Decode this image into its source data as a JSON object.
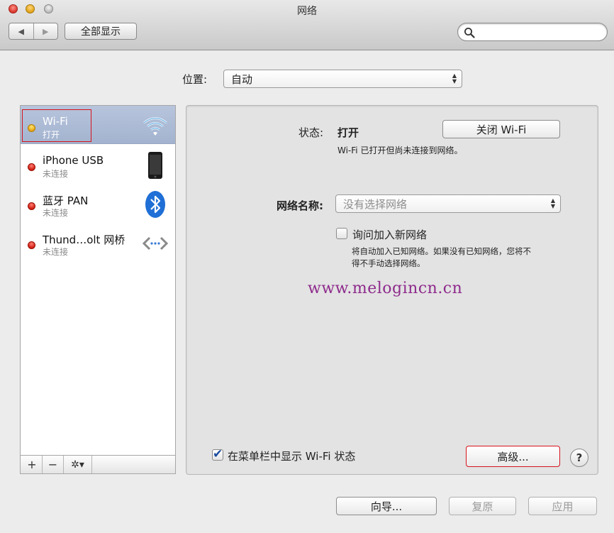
{
  "window": {
    "title": "网络"
  },
  "toolbar": {
    "back_glyph": "◀",
    "forward_glyph": "▶",
    "show_all_label": "全部显示",
    "search_placeholder": ""
  },
  "location": {
    "label": "位置:",
    "value": "自动"
  },
  "services": [
    {
      "name": "Wi-Fi",
      "status": "打开",
      "status_color": "yellow",
      "icon": "wifi-icon",
      "selected": true
    },
    {
      "name": "iPhone USB",
      "status": "未连接",
      "status_color": "red",
      "icon": "iphone-icon",
      "selected": false
    },
    {
      "name": "蓝牙 PAN",
      "status": "未连接",
      "status_color": "red",
      "icon": "bluetooth-icon",
      "selected": false
    },
    {
      "name": "Thund…olt 网桥",
      "status": "未连接",
      "status_color": "red",
      "icon": "thunderbolt-bridge-icon",
      "selected": false
    }
  ],
  "sidebar_footer": {
    "add": "+",
    "remove": "−",
    "action": "✲▾"
  },
  "detail": {
    "status_label": "状态:",
    "status_value": "打开",
    "toggle_wifi_label": "关闭 Wi-Fi",
    "status_description": "Wi-Fi 已打开但尚未连接到网络。",
    "network_name_label": "网络名称:",
    "network_name_placeholder": "没有选择网络",
    "ask_join_label": "询问加入新网络",
    "ask_join_checked": false,
    "ask_join_desc_line1": "将自动加入已知网络。如果没有已知网络，您将不",
    "ask_join_desc_line2": "得不手动选择网络。",
    "watermark": "www.melogincn.cn",
    "show_menubar_label": "在菜单栏中显示 Wi-Fi 状态",
    "show_menubar_checked": true,
    "advanced_label": "高级...",
    "help_label": "?"
  },
  "footer": {
    "assistant_label": "向导...",
    "revert_label": "复原",
    "apply_label": "应用"
  },
  "colors": {
    "selection": "#a9b8d3",
    "highlight_box": "#d6141c",
    "watermark": "#8e2b8c",
    "checkmark": "#1a4da0"
  }
}
